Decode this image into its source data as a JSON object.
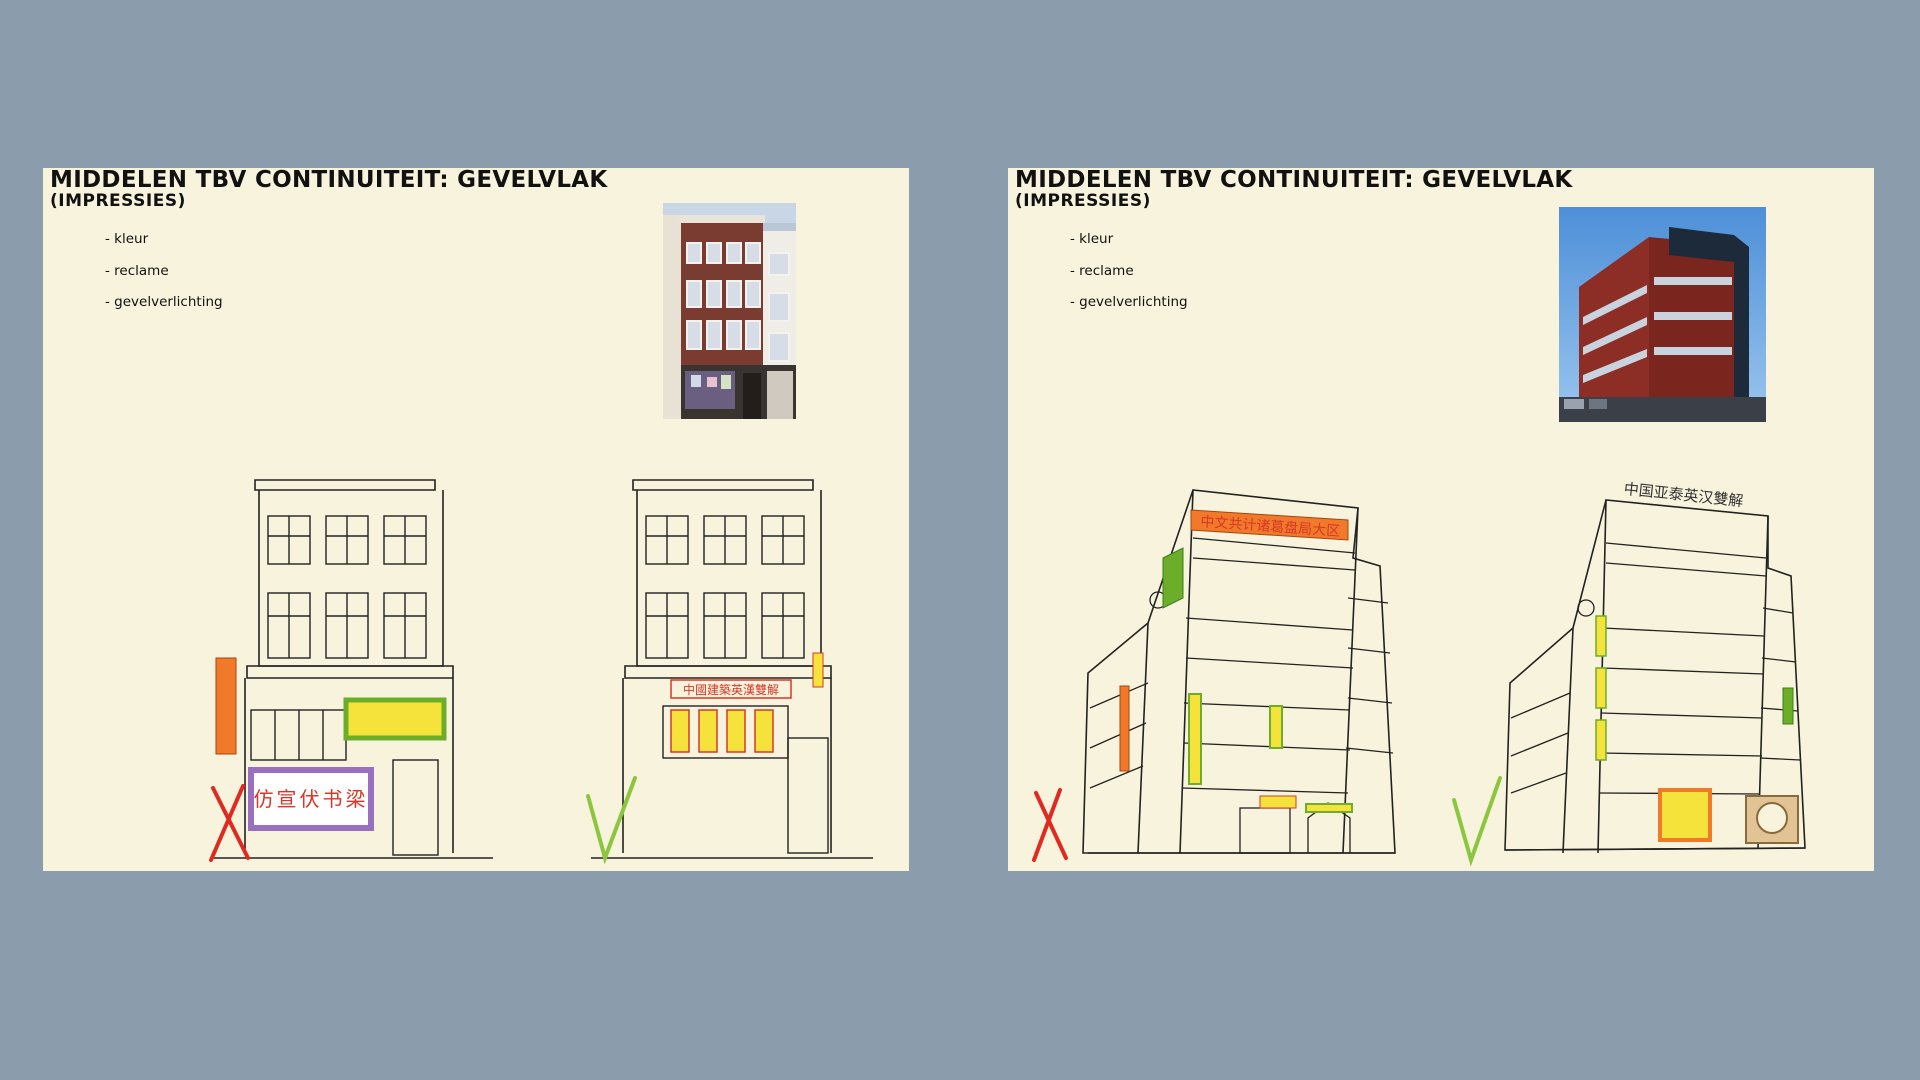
{
  "slides": [
    {
      "title": "MIDDELEN TBV CONTINUITEIT: GEVELVLAK",
      "subtitle": "(IMPRESSIES)",
      "bullets": [
        "- kleur",
        "- reclame",
        "- gevelverlichting"
      ],
      "photo": "photo-dutch-townhouse",
      "sketches": [
        {
          "verdict": "wrong",
          "mark": "cross-mark",
          "description_icon": "townhouse-sketch-with-bright-signs"
        },
        {
          "verdict": "right",
          "mark": "check-mark",
          "description_icon": "townhouse-sketch-with-subtle-signs"
        }
      ]
    },
    {
      "title": "MIDDELEN TBV CONTINUITEIT: GEVELVLAK",
      "subtitle": "(IMPRESSIES)",
      "bullets": [
        "- kleur",
        "- reclame",
        "- gevelverlichting"
      ],
      "photo": "photo-red-brick-office",
      "sketches": [
        {
          "verdict": "wrong",
          "mark": "cross-mark",
          "description_icon": "office-sketch-with-bright-signs"
        },
        {
          "verdict": "right",
          "mark": "check-mark",
          "description_icon": "office-sketch-with-subtle-signs"
        }
      ]
    }
  ],
  "colors": {
    "background": "#8b9cad",
    "slide": "#f8f3dc",
    "cross": "#e02a20",
    "check": "#8cc63e",
    "sign_orange": "#f07a2a",
    "sign_green": "#8cc63e",
    "sign_yellow": "#f5e23a",
    "sign_purple": "#9a6fc0",
    "sign_red_text": "#d8372a"
  }
}
